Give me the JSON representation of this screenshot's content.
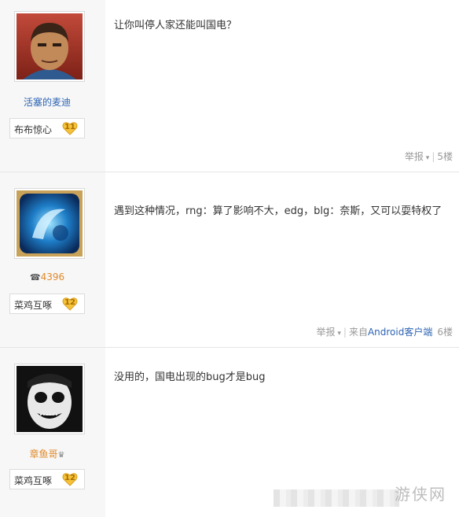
{
  "posts": [
    {
      "username": "活塞的麦迪",
      "badge_name": "布布惊心",
      "badge_level": "11",
      "content": "让你叫停人家还能叫国电？",
      "report": "举报",
      "floor": "5楼"
    },
    {
      "username": "4396",
      "badge_name": "菜鸡互啄",
      "badge_level": "12",
      "content": "遇到这种情况，rng：算了影响不大，edg，blg：奈斯，又可以耍特权了",
      "report": "举报",
      "source_prefix": "来自",
      "source_app": "Android客户端",
      "floor": "6楼"
    },
    {
      "username": "章鱼哥",
      "badge_name": "菜鸡互啄",
      "badge_level": "12",
      "content": "没用的，国电出现的bug才是bug"
    }
  ],
  "watermark": "游侠网",
  "colors": {
    "username": "#2d64b3",
    "username_orange": "#e08a2a",
    "badge_gold": "#f5c23a",
    "divider": "#e5e5e5"
  }
}
